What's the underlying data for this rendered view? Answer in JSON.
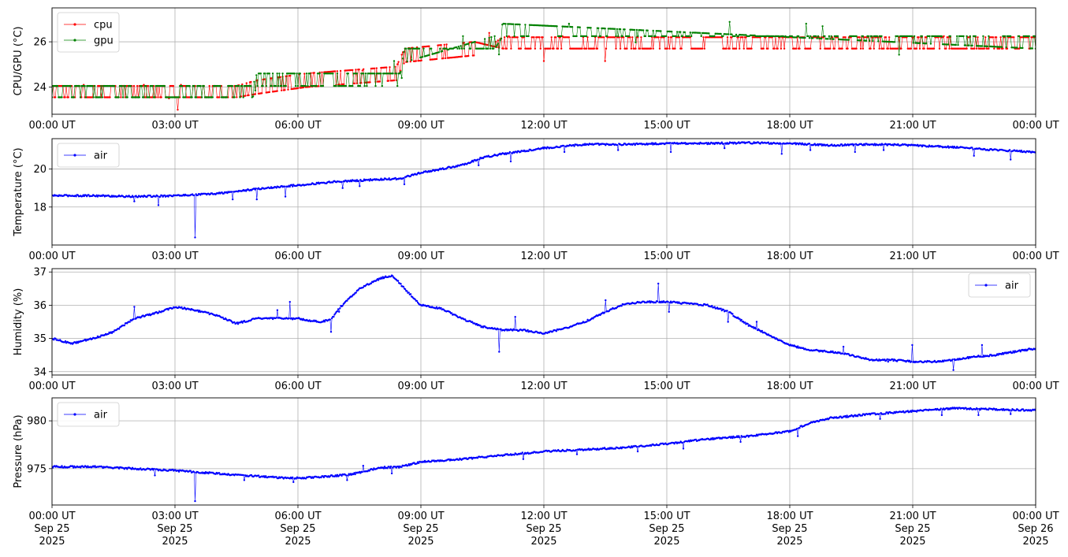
{
  "colors": {
    "cpu": "#ff0000",
    "gpu": "#008000",
    "air": "#0000ff",
    "grid": "#b0b0b0"
  },
  "chart_data": [
    {
      "type": "line",
      "ylabel": "CPU/GPU (°C)",
      "xlim": [
        0,
        24
      ],
      "ylim": [
        22.8,
        27.5
      ],
      "yticks": [
        24,
        26
      ],
      "xtick_labels": [
        "00:00 UT",
        "03:00 UT",
        "06:00 UT",
        "09:00 UT",
        "12:00 UT",
        "15:00 UT",
        "18:00 UT",
        "21:00 UT",
        "00:00 UT"
      ],
      "grid": true,
      "legend": "upper-left",
      "series": [
        {
          "name": "cpu",
          "color": "#ff0000",
          "base": [
            [
              0,
              23.55
            ],
            [
              4.5,
              23.55
            ],
            [
              5,
              23.7
            ],
            [
              6.2,
              24.0
            ],
            [
              8.4,
              24.3
            ],
            [
              8.6,
              25.1
            ],
            [
              10.3,
              25.4
            ],
            [
              11.0,
              26.2
            ],
            [
              24,
              26.2
            ]
          ],
          "alt": [
            [
              0,
              24.05
            ],
            [
              4.5,
              24.05
            ],
            [
              5,
              24.3
            ],
            [
              6.2,
              24.6
            ],
            [
              8.4,
              24.9
            ],
            [
              8.6,
              25.7
            ],
            [
              10.3,
              26.0
            ],
            [
              11.0,
              25.7
            ],
            [
              24,
              25.7
            ]
          ]
        },
        {
          "name": "gpu",
          "color": "#008000",
          "base": [
            [
              0,
              24.05
            ],
            [
              4.9,
              24.05
            ],
            [
              5,
              24.6
            ],
            [
              8.5,
              24.6
            ],
            [
              8.6,
              25.7
            ],
            [
              10.8,
              25.7
            ],
            [
              11.0,
              26.25
            ],
            [
              24,
              26.25
            ]
          ],
          "alt": [
            [
              0,
              23.55
            ],
            [
              4.9,
              23.55
            ],
            [
              5,
              24.05
            ],
            [
              8.5,
              24.05
            ],
            [
              8.6,
              25.1
            ],
            [
              10.8,
              26.25
            ],
            [
              11.0,
              26.8
            ],
            [
              24,
              25.7
            ]
          ]
        }
      ]
    },
    {
      "type": "line",
      "ylabel": "Temperature (°C)",
      "xlim": [
        0,
        24
      ],
      "ylim": [
        16.0,
        21.6
      ],
      "yticks": [
        18,
        20
      ],
      "xtick_labels": [
        "00:00 UT",
        "03:00 UT",
        "06:00 UT",
        "09:00 UT",
        "12:00 UT",
        "15:00 UT",
        "18:00 UT",
        "21:00 UT",
        "00:00 UT"
      ],
      "grid": true,
      "legend": "upper-left",
      "series": [
        {
          "name": "air",
          "color": "#0000ff",
          "points": [
            [
              0,
              18.6
            ],
            [
              1,
              18.6
            ],
            [
              2,
              18.55
            ],
            [
              3,
              18.6
            ],
            [
              4,
              18.7
            ],
            [
              5,
              18.95
            ],
            [
              6,
              19.15
            ],
            [
              7,
              19.35
            ],
            [
              8,
              19.45
            ],
            [
              8.5,
              19.5
            ],
            [
              9,
              19.8
            ],
            [
              10,
              20.2
            ],
            [
              10.5,
              20.6
            ],
            [
              11,
              20.8
            ],
            [
              12,
              21.1
            ],
            [
              13,
              21.3
            ],
            [
              14,
              21.3
            ],
            [
              15,
              21.35
            ],
            [
              16,
              21.35
            ],
            [
              17,
              21.38
            ],
            [
              18,
              21.35
            ],
            [
              19,
              21.25
            ],
            [
              20,
              21.3
            ],
            [
              21,
              21.25
            ],
            [
              22,
              21.15
            ],
            [
              23,
              21.0
            ],
            [
              24,
              20.9
            ]
          ],
          "spikes": [
            [
              3.5,
              16.4
            ],
            [
              2.0,
              18.3
            ],
            [
              2.6,
              18.1
            ],
            [
              4.4,
              18.4
            ],
            [
              5.0,
              18.4
            ],
            [
              5.7,
              18.55
            ],
            [
              7.1,
              19.0
            ],
            [
              7.5,
              19.1
            ],
            [
              8.6,
              19.2
            ],
            [
              10.4,
              20.2
            ],
            [
              11.2,
              20.4
            ],
            [
              12.5,
              20.9
            ],
            [
              13.8,
              21.0
            ],
            [
              15.1,
              20.9
            ],
            [
              16.4,
              21.1
            ],
            [
              17.8,
              20.8
            ],
            [
              18.5,
              21.0
            ],
            [
              19.6,
              20.9
            ],
            [
              20.3,
              21.0
            ],
            [
              22.5,
              20.7
            ],
            [
              23.4,
              20.5
            ]
          ]
        }
      ]
    },
    {
      "type": "line",
      "ylabel": "Humidity (%)",
      "xlim": [
        0,
        24
      ],
      "ylim": [
        33.9,
        37.1
      ],
      "yticks": [
        34,
        35,
        36,
        37
      ],
      "xtick_labels": [
        "00:00 UT",
        "03:00 UT",
        "06:00 UT",
        "09:00 UT",
        "12:00 UT",
        "15:00 UT",
        "18:00 UT",
        "21:00 UT",
        "00:00 UT"
      ],
      "grid": true,
      "legend": "upper-right",
      "series": [
        {
          "name": "air",
          "color": "#0000ff",
          "points": [
            [
              0,
              35.0
            ],
            [
              0.3,
              34.9
            ],
            [
              0.5,
              34.85
            ],
            [
              1,
              35.0
            ],
            [
              1.5,
              35.2
            ],
            [
              2,
              35.6
            ],
            [
              2.5,
              35.75
            ],
            [
              3,
              35.95
            ],
            [
              3.5,
              35.85
            ],
            [
              4,
              35.7
            ],
            [
              4.5,
              35.45
            ],
            [
              5,
              35.6
            ],
            [
              5.5,
              35.6
            ],
            [
              6,
              35.6
            ],
            [
              6.5,
              35.5
            ],
            [
              6.8,
              35.55
            ],
            [
              7,
              35.9
            ],
            [
              7.5,
              36.5
            ],
            [
              8,
              36.8
            ],
            [
              8.3,
              36.9
            ],
            [
              8.6,
              36.5
            ],
            [
              9,
              36.0
            ],
            [
              9.5,
              35.9
            ],
            [
              10,
              35.6
            ],
            [
              10.5,
              35.35
            ],
            [
              11,
              35.25
            ],
            [
              11.5,
              35.25
            ],
            [
              12,
              35.15
            ],
            [
              12.5,
              35.3
            ],
            [
              13,
              35.5
            ],
            [
              13.5,
              35.8
            ],
            [
              14,
              36.05
            ],
            [
              14.5,
              36.1
            ],
            [
              15,
              36.1
            ],
            [
              15.5,
              36.05
            ],
            [
              16,
              36.0
            ],
            [
              16.5,
              35.8
            ],
            [
              17,
              35.4
            ],
            [
              17.5,
              35.1
            ],
            [
              18,
              34.8
            ],
            [
              18.5,
              34.65
            ],
            [
              19,
              34.6
            ],
            [
              19.5,
              34.5
            ],
            [
              20,
              34.35
            ],
            [
              20.5,
              34.35
            ],
            [
              21,
              34.3
            ],
            [
              21.5,
              34.3
            ],
            [
              22,
              34.35
            ],
            [
              22.5,
              34.45
            ],
            [
              23,
              34.5
            ],
            [
              23.5,
              34.6
            ],
            [
              24,
              34.7
            ]
          ],
          "spikes": [
            [
              2.0,
              35.95
            ],
            [
              5.5,
              35.85
            ],
            [
              5.8,
              36.1
            ],
            [
              6.8,
              35.2
            ],
            [
              7.0,
              35.8
            ],
            [
              10.9,
              34.6
            ],
            [
              11.3,
              35.65
            ],
            [
              13.5,
              36.15
            ],
            [
              14.8,
              36.65
            ],
            [
              15.05,
              35.8
            ],
            [
              16.5,
              35.5
            ],
            [
              17.2,
              35.5
            ],
            [
              19.3,
              34.75
            ],
            [
              20.4,
              34.3
            ],
            [
              21.0,
              34.8
            ],
            [
              22.0,
              34.05
            ],
            [
              22.7,
              34.8
            ]
          ]
        }
      ]
    },
    {
      "type": "line",
      "ylabel": "Pressure (hPa)",
      "xlim": [
        0,
        24
      ],
      "ylim": [
        971.2,
        982.4
      ],
      "yticks": [
        975,
        980
      ],
      "xtick_labels": [
        "00:00 UT\nSep 25\n2025",
        "03:00 UT\nSep 25\n2025",
        "06:00 UT\nSep 25\n2025",
        "09:00 UT\nSep 25\n2025",
        "12:00 UT\nSep 25\n2025",
        "15:00 UT\nSep 25\n2025",
        "18:00 UT\nSep 25\n2025",
        "21:00 UT\nSep 25\n2025",
        "00:00 UT\nSep 26\n2025"
      ],
      "grid": true,
      "legend": "upper-left",
      "series": [
        {
          "name": "air",
          "color": "#0000ff",
          "points": [
            [
              0,
              975.2
            ],
            [
              1,
              975.2
            ],
            [
              2,
              975.0
            ],
            [
              3,
              974.8
            ],
            [
              4,
              974.5
            ],
            [
              5,
              974.2
            ],
            [
              5.8,
              974.0
            ],
            [
              6.5,
              974.1
            ],
            [
              7.3,
              974.4
            ],
            [
              8,
              975.1
            ],
            [
              8.5,
              975.2
            ],
            [
              9,
              975.7
            ],
            [
              10,
              976.0
            ],
            [
              11,
              976.4
            ],
            [
              12,
              976.8
            ],
            [
              13,
              977.0
            ],
            [
              14,
              977.2
            ],
            [
              15,
              977.6
            ],
            [
              16,
              978.1
            ],
            [
              17,
              978.4
            ],
            [
              18,
              978.9
            ],
            [
              18.5,
              979.8
            ],
            [
              19,
              980.3
            ],
            [
              20,
              980.7
            ],
            [
              21,
              981.0
            ],
            [
              22,
              981.3
            ],
            [
              23,
              981.2
            ],
            [
              24,
              981.1
            ]
          ],
          "spikes": [
            [
              3.5,
              971.6
            ],
            [
              2.5,
              974.3
            ],
            [
              4.7,
              973.8
            ],
            [
              5.9,
              973.6
            ],
            [
              7.2,
              973.8
            ],
            [
              7.6,
              975.3
            ],
            [
              8.3,
              974.5
            ],
            [
              11.5,
              976.0
            ],
            [
              12.8,
              976.5
            ],
            [
              14.3,
              976.8
            ],
            [
              15.4,
              977.1
            ],
            [
              16.8,
              977.8
            ],
            [
              18.2,
              978.4
            ],
            [
              20.2,
              980.2
            ],
            [
              21.7,
              980.6
            ],
            [
              22.6,
              980.6
            ],
            [
              23.4,
              980.7
            ]
          ]
        }
      ]
    }
  ]
}
